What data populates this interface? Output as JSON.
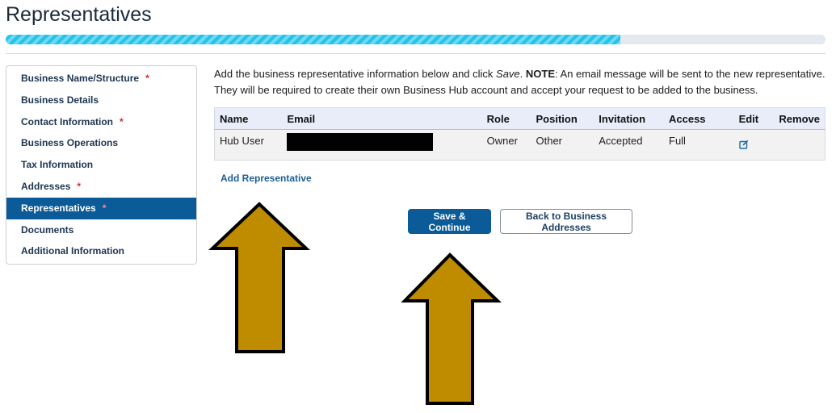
{
  "page": {
    "title": "Representatives",
    "progress": 0.75
  },
  "sidebar": {
    "items": [
      {
        "label": "Business Name/Structure",
        "required": "*"
      },
      {
        "label": "Business Details",
        "required": ""
      },
      {
        "label": "Contact Information",
        "required": "*"
      },
      {
        "label": "Business Operations",
        "required": ""
      },
      {
        "label": "Tax Information",
        "required": ""
      },
      {
        "label": "Addresses",
        "required": "*"
      },
      {
        "label": "Representatives",
        "required": "*"
      },
      {
        "label": "Documents",
        "required": ""
      },
      {
        "label": "Additional Information",
        "required": ""
      }
    ]
  },
  "intro": {
    "part1": "Add the business representative information below and click ",
    "save_word": "Save",
    "part2": ". ",
    "note_label": "NOTE",
    "part3": ": An email message will be sent to the new representative. They will be required to create their own Business Hub account and accept your request to be added to the business."
  },
  "table": {
    "headers": [
      "Name",
      "Email",
      "Role",
      "Position",
      "Invitation",
      "Access",
      "Edit",
      "Remove"
    ],
    "rows": [
      {
        "name": "Hub User",
        "role": "Owner",
        "position": "Other",
        "invitation": "Accepted",
        "access": "Full"
      }
    ]
  },
  "actions": {
    "add_representative": "Add Representative",
    "save_continue": "Save & Continue",
    "back": "Back to Business Addresses"
  },
  "colors": {
    "accent": "#0a5b97",
    "progress": "#23c3ea",
    "required": "#d9262c",
    "annotation_arrow": "#bf8c00"
  },
  "icons": {
    "edit": "edit-icon",
    "annotation": "up-arrow"
  }
}
